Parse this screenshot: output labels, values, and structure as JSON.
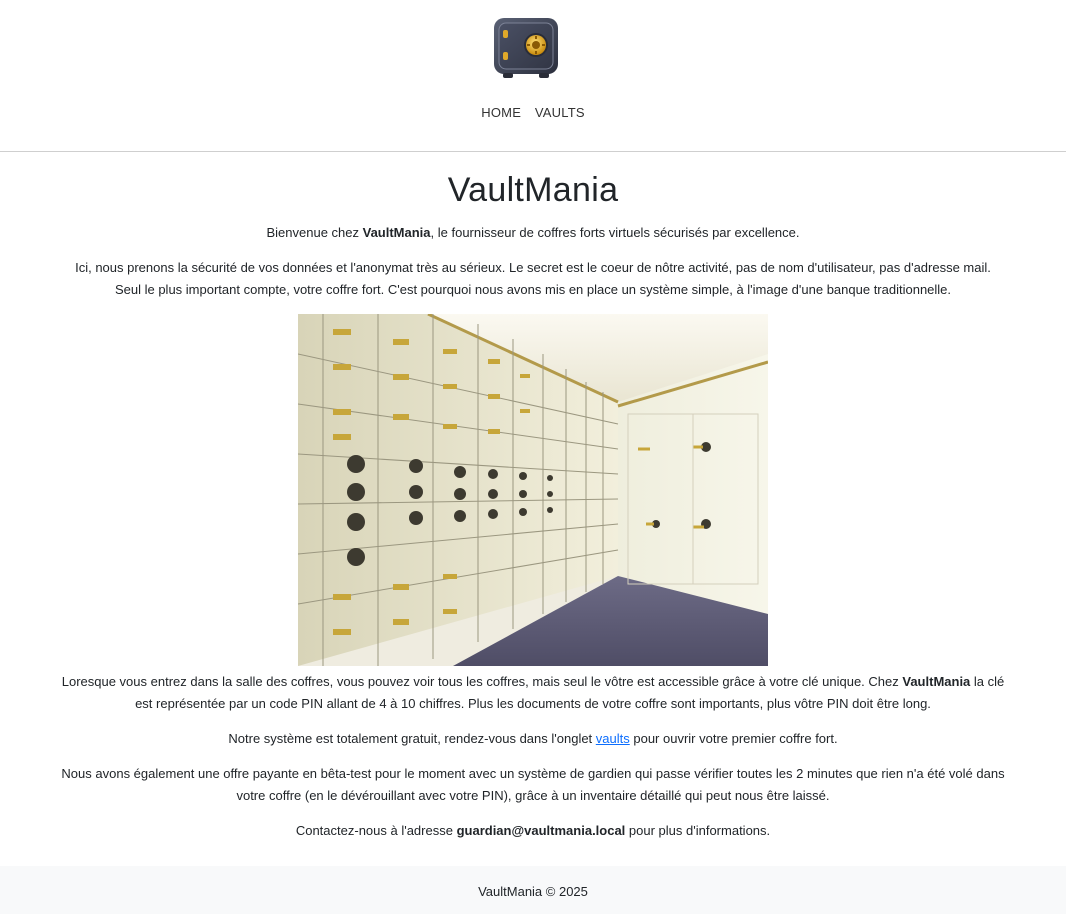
{
  "header": {
    "nav": [
      "HOME",
      "VAULTS"
    ]
  },
  "main": {
    "title": "VaultMania",
    "p1": {
      "before": "Bienvenue chez ",
      "brand": "VaultMania",
      "after": ", le fournisseur de coffres forts virtuels sécurisés par excellence."
    },
    "p2_line1": "Ici, nous prenons la sécurité de vos données et l'anonymat très au sérieux. Le secret est le coeur de nôtre activité, pas de nom d'utilisateur, pas d'adresse mail.",
    "p2_line2": "Seul le plus important compte, votre coffre fort. C'est pourquoi nous avons mis en place un système simple, à l'image d'une banque traditionnelle.",
    "p3": {
      "before": "Loresque vous entrez dans la salle des coffres, vous pouvez voir tous les coffres, mais seul le vôtre est accessible grâce à votre clé unique. Chez ",
      "brand": "VaultMania",
      "after": " la clé est représentée par un code PIN allant de 4 à 10 chiffres. Plus les documents de votre coffre sont importants, plus vôtre PIN doit être long."
    },
    "p4": {
      "before": "Notre système est totalement gratuit, rendez-vous dans l'onglet ",
      "link": "vaults",
      "after": " pour ouvrir votre premier coffre fort."
    },
    "p5": "Nous avons également une offre payante en bêta-test pour le moment avec un système de gardien qui passe vérifier toutes les 2 minutes que rien n'a été volé dans votre coffre (en le dévérouillant avec votre PIN), grâce à un inventaire détaillé qui peut nous être laissé.",
    "p6": {
      "before": "Contactez-nous à l'adresse ",
      "email": "guardian@vaultmania.local",
      "after": " pour plus d'informations."
    }
  },
  "footer": {
    "text": "VaultMania © 2025"
  },
  "colors": {
    "link": "#0d6efd",
    "footer_bg": "#f8f9fa",
    "text": "#212529"
  },
  "icons": [
    "safe-logo-icon",
    "vault-room-photo"
  ]
}
